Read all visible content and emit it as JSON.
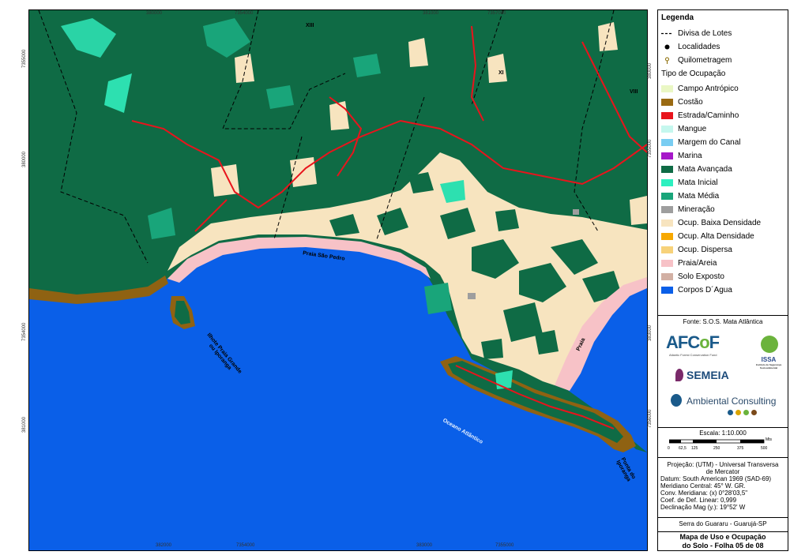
{
  "map": {
    "coords_top": [
      "380000",
      "7354000",
      "381000",
      "7357000"
    ],
    "coords_bottom": [
      "382000",
      "7354000",
      "383000",
      "7355000"
    ],
    "coords_left": [
      "7355000",
      "380000",
      "7354000",
      "381000"
    ],
    "coords_right": [
      "380000",
      "7355000",
      "383000",
      "7356000"
    ],
    "lot_labels": [
      "XIII",
      "XI",
      "VIII"
    ],
    "place_labels": {
      "praia_sao_pedro": "Praia São Pedro",
      "ilhote": "Ilhote Praia Grande\nou Iporanga",
      "oceano": "Oceano Atlântico",
      "praia": "Praia",
      "ponta": "Ponta do\nIporanga"
    },
    "colors": {
      "ocean": "#0a5fe8",
      "forest": "#0f6b45",
      "beach": "#f7c2c7",
      "low_density": "#f7e4bf",
      "rock": "#8f6212",
      "road": "#e8141c",
      "mangrove": "#2de0b0",
      "medium_forest": "#19a57a"
    }
  },
  "legend": {
    "title": "Legenda",
    "items": [
      {
        "label": "Divisa de Lotes",
        "kind": "dash"
      },
      {
        "label": "Localidades",
        "kind": "dot"
      },
      {
        "label": "Quilometragem",
        "kind": "km"
      }
    ],
    "subtitle": "Tipo de Ocupação",
    "classes": [
      {
        "label": "Campo Antrópico",
        "color": "#eaf7c4"
      },
      {
        "label": "Costão",
        "color": "#9a6a12"
      },
      {
        "label": "Estrada/Caminho",
        "color": "#e8141c"
      },
      {
        "label": "Mangue",
        "color": "#c5f7ee"
      },
      {
        "label": "Margem do Canal",
        "color": "#79cdf2"
      },
      {
        "label": "Marina",
        "color": "#a618c9"
      },
      {
        "label": "Mata Avançada",
        "color": "#0f6b45"
      },
      {
        "label": "Mata Inicial",
        "color": "#2df0c0"
      },
      {
        "label": "Mata Média",
        "color": "#19a57a"
      },
      {
        "label": "Mineração",
        "color": "#9e9e9e"
      },
      {
        "label": "Ocup. Baixa Densidade",
        "color": "#f7e4bf"
      },
      {
        "label": "Ocup. Alta Densidade",
        "color": "#f7a800"
      },
      {
        "label": "Ocup. Dispersa",
        "color": "#f7d27a"
      },
      {
        "label": "Praia/Areia",
        "color": "#f7c2c7"
      },
      {
        "label": "Solo Exposto",
        "color": "#d2b0a4"
      },
      {
        "label": "Corpos D´Agua",
        "color": "#0a5fe8"
      }
    ],
    "source": "Fonte: S.O.S. Mata Atlântica"
  },
  "logos": {
    "afcof": "AFCoF",
    "afcof_sub": "Atlantic Forest Conservation Fund",
    "semeia": "SEMEIA",
    "issa": "ISSA",
    "issa_sub": "Instituto de Segurança Socioambiental",
    "ambiental": "Ambiental Consulting"
  },
  "scale": {
    "label": "Escala: 1:10.000",
    "ticks": [
      "0",
      "62,5",
      "125",
      "250",
      "375",
      "500"
    ],
    "unit": "Mts"
  },
  "projection": {
    "lines": [
      "Projeção: (UTM) - Universal Transversa",
      "de Mercator",
      "Datum: South American 1969 (SAD-69)",
      "Meridiano Central: 45° W. GR.",
      "Conv. Meridiana: (x) 0°28'03,5\"",
      "Coef. de Def. Linear: 0,999",
      "Declinação Mag (y.): 19°52' W"
    ]
  },
  "location": "Serra do Guararu - Guarujá-SP",
  "title": {
    "line1": "Mapa de Uso e Ocupação",
    "line2": "do Solo - Folha 05 de 08"
  }
}
